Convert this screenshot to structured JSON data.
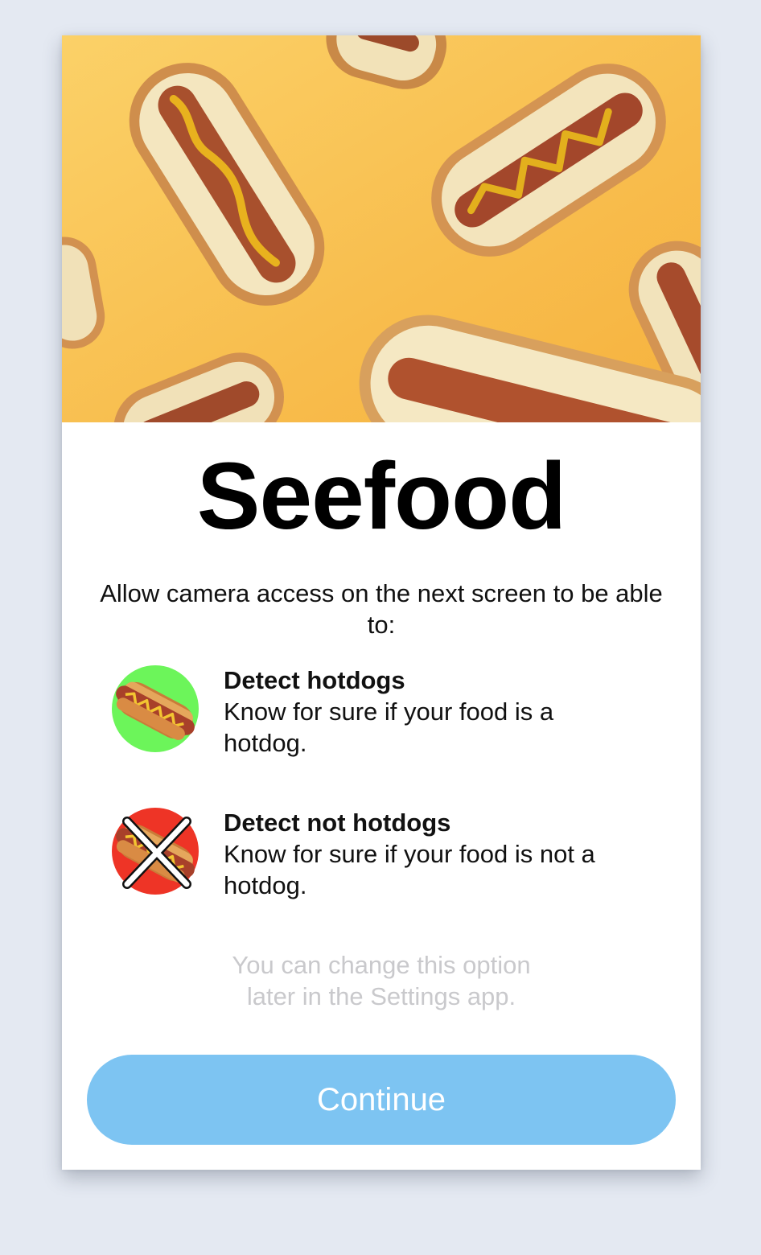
{
  "app": {
    "title": "Seefood",
    "intro": "Allow camera access on the next screen to be able to:"
  },
  "hero": {
    "image": "hotdogs-on-yellow-background",
    "background_color": "#f8b94a"
  },
  "features": [
    {
      "icon": "hotdog-icon",
      "badge_color": "#6cf55a",
      "heading": "Detect hotdogs",
      "description": "Know for sure if your food is a hotdog."
    },
    {
      "icon": "crossed-hotdog-icon",
      "badge_color": "#ee3426",
      "heading": "Detect not hotdogs",
      "description": "Know for sure if your food is not a hotdog."
    }
  ],
  "note": {
    "line1": "You can change this option",
    "line2": "later in the Settings app."
  },
  "actions": {
    "continue_label": "Continue",
    "continue_color": "#7dc4f2"
  }
}
